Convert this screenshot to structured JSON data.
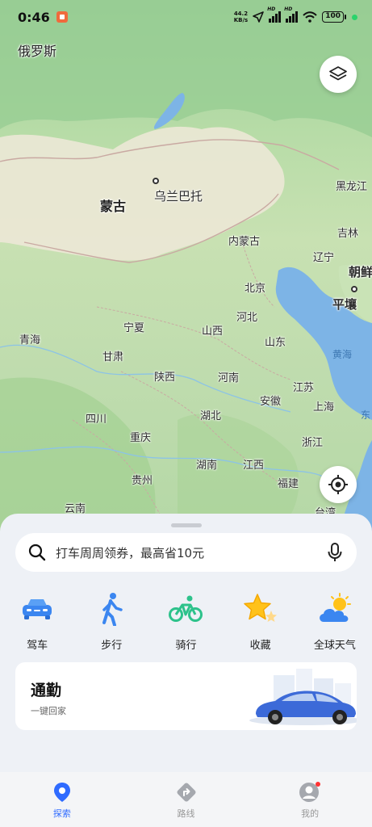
{
  "status_bar": {
    "time": "0:46",
    "net_speed_value": "44.2",
    "net_speed_unit": "KB/s",
    "hd_label": "HD",
    "battery": "100"
  },
  "map": {
    "labels": {
      "russia": "俄罗斯",
      "mongolia": "蒙古",
      "ulaanbaatar": "乌兰巴托",
      "heilongjiang": "黑龙江",
      "jilin": "吉林",
      "inner_mongolia": "内蒙古",
      "liaoning": "辽宁",
      "korea": "朝鲜",
      "beijing": "北京",
      "pyongyang": "平壤",
      "hebei": "河北",
      "ningxia": "宁夏",
      "shanxi": "山西",
      "qinghai": "青海",
      "shandong": "山东",
      "yellow_sea": "黄海",
      "gansu": "甘肃",
      "shaanxi": "陕西",
      "henan": "河南",
      "jiangsu": "江苏",
      "anhui": "安徽",
      "shanghai": "上海",
      "east_sea": "东",
      "sichuan": "四川",
      "hubei": "湖北",
      "chongqing": "重庆",
      "zhejiang": "浙江",
      "hunan": "湖南",
      "jiangxi": "江西",
      "guizhou": "贵州",
      "fujian": "福建",
      "yunnan": "云南",
      "taiwan": "台湾"
    },
    "layers_button_icon": "layers-icon",
    "locate_button_icon": "locate-icon"
  },
  "sheet": {
    "search_placeholder": "打车周周领券，最高省10元",
    "actions": [
      {
        "label": "驾车",
        "icon": "car-icon"
      },
      {
        "label": "步行",
        "icon": "walk-icon"
      },
      {
        "label": "骑行",
        "icon": "bike-icon"
      },
      {
        "label": "收藏",
        "icon": "star-icon"
      },
      {
        "label": "全球天气",
        "icon": "weather-icon"
      }
    ],
    "commute": {
      "title": "通勤",
      "subtitle": "一键回家"
    }
  },
  "tabs": [
    {
      "label": "探索",
      "active": true
    },
    {
      "label": "路线",
      "active": false
    },
    {
      "label": "我的",
      "active": false
    }
  ],
  "colors": {
    "accent": "#2f6bff",
    "sea": "#7db4e6",
    "land": "#bcdcab"
  }
}
